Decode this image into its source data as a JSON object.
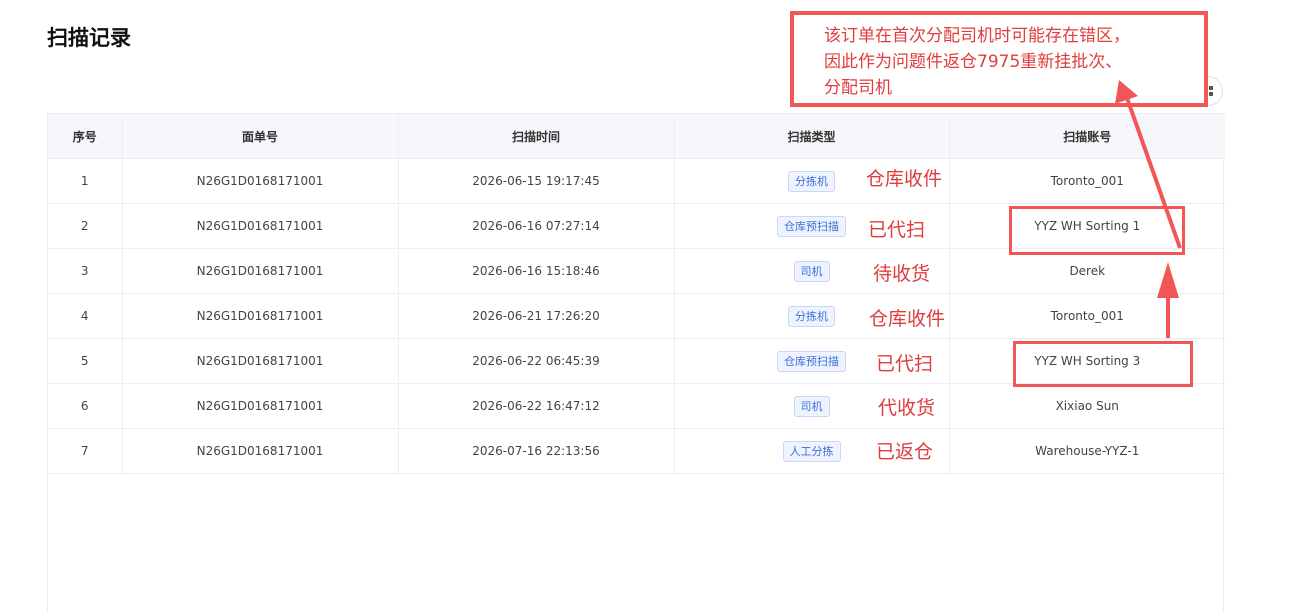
{
  "page": {
    "title": "扫描记录"
  },
  "table": {
    "columns": [
      "序号",
      "面单号",
      "扫描时间",
      "扫描类型",
      "扫描账号"
    ],
    "rows": [
      {
        "index": "1",
        "waybill": "N26G1D0168171001",
        "time": "2026-06-15 19:17:45",
        "type": "分拣机",
        "account": "Toronto_001"
      },
      {
        "index": "2",
        "waybill": "N26G1D0168171001",
        "time": "2026-06-16 07:27:14",
        "type": "仓库预扫描",
        "account": "YYZ WH Sorting 1"
      },
      {
        "index": "3",
        "waybill": "N26G1D0168171001",
        "time": "2026-06-16 15:18:46",
        "type": "司机",
        "account": "Derek"
      },
      {
        "index": "4",
        "waybill": "N26G1D0168171001",
        "time": "2026-06-21 17:26:20",
        "type": "分拣机",
        "account": "Toronto_001"
      },
      {
        "index": "5",
        "waybill": "N26G1D0168171001",
        "time": "2026-06-22 06:45:39",
        "type": "仓库预扫描",
        "account": "YYZ WH Sorting 3"
      },
      {
        "index": "6",
        "waybill": "N26G1D0168171001",
        "time": "2026-06-22 16:47:12",
        "type": "司机",
        "account": "Xixiao Sun"
      },
      {
        "index": "7",
        "waybill": "N26G1D0168171001",
        "time": "2026-07-16 22:13:56",
        "type": "人工分拣",
        "account": "Warehouse-YYZ-1"
      }
    ]
  },
  "annotations": {
    "note_lines": [
      "该订单在首次分配司机时可能存在错区，",
      "因此作为问题件返仓7975重新挂批次、",
      "分配司机"
    ],
    "row_labels": [
      "仓库收件",
      "已代扫",
      "待收货",
      "仓库收件",
      "已代扫",
      "代收货",
      "已返仓"
    ],
    "color": "#f25757"
  },
  "icons": {
    "settings": "column-settings-icon"
  }
}
